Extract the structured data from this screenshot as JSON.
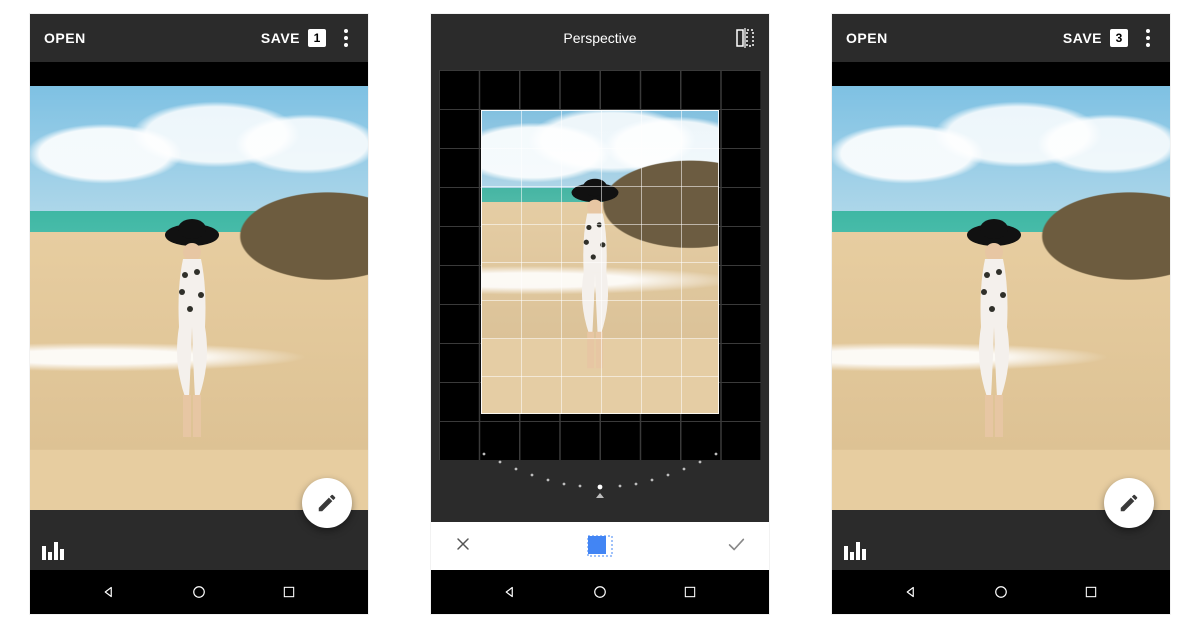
{
  "screens": {
    "home1": {
      "open_label": "OPEN",
      "save_label": "SAVE",
      "save_count": "1"
    },
    "perspective": {
      "title": "Perspective"
    },
    "home2": {
      "open_label": "OPEN",
      "save_label": "SAVE",
      "save_count": "3"
    }
  },
  "colors": {
    "accent": "#4285f4",
    "bg_dark": "#2b2b2b",
    "black": "#000000",
    "white": "#ffffff"
  }
}
